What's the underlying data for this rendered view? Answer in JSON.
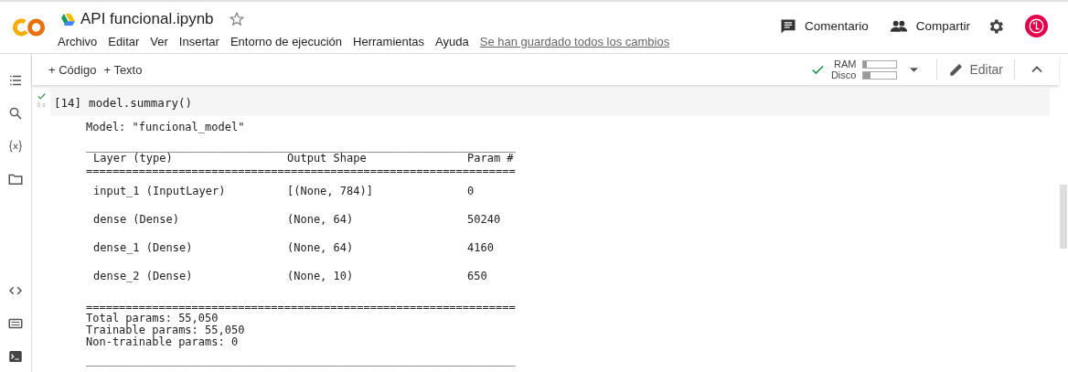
{
  "header": {
    "title": "API funcional.ipynb",
    "starred": false,
    "menu": [
      "Archivo",
      "Editar",
      "Ver",
      "Insertar",
      "Entorno de ejecución",
      "Herramientas",
      "Ayuda"
    ],
    "save_status": "Se han guardado todos los cambios",
    "comment_button": "Comentario",
    "share_button": "Compartir"
  },
  "toolbar": {
    "add_code": "+ Código",
    "add_text": "+ Texto",
    "connected": true,
    "ram": {
      "label": "RAM",
      "level": 0.1
    },
    "disk": {
      "label": "Disco",
      "level": 0.2
    },
    "edit_button": "Editar"
  },
  "cell": {
    "count": "[14]",
    "code": "model.summary()",
    "done": true,
    "time": "0 s",
    "output": {
      "model_line": "Model: \"funcional_model\"",
      "rule_top": "_________________________________________________________________",
      "header": [
        "Layer (type)",
        "Output Shape",
        "Param #"
      ],
      "double_rule": "=================================================================",
      "rows": [
        [
          "input_1 (InputLayer)",
          "[(None, 784)]",
          "0"
        ],
        [
          "dense (Dense)",
          "(None, 64)",
          "50240"
        ],
        [
          "dense_1 (Dense)",
          "(None, 64)",
          "4160"
        ],
        [
          "dense_2 (Dense)",
          "(None, 10)",
          "650"
        ]
      ],
      "double_rule_bottom": "=================================================================",
      "totals": [
        "Total params: 55,050",
        "Trainable params: 55,050",
        "Non-trainable params: 0"
      ],
      "rule_bottom": "_________________________________________________________________"
    }
  }
}
